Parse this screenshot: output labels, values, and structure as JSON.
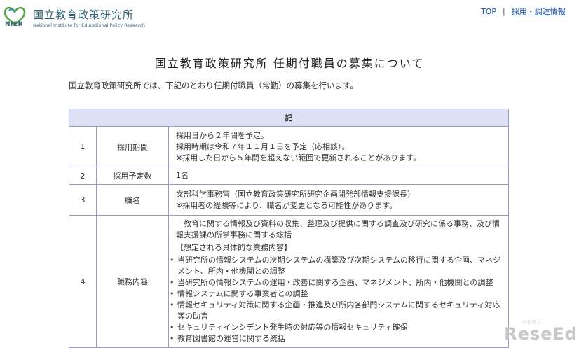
{
  "header": {
    "logo_title": "国立教育政策研究所",
    "logo_acronym": "NIER",
    "logo_subtitle": "National Institute for Educational Policy Research",
    "nav": [
      {
        "label": "TOP"
      },
      {
        "label": "採用・調達情報"
      }
    ],
    "nav_separator": "|"
  },
  "page": {
    "title": "国立教育政策研究所 任期付職員の募集について",
    "intro": "国立教育政策研究所では、下記のとおり任期付職員（常勤）の募集を行います。"
  },
  "table": {
    "header": "記",
    "rows": [
      {
        "num": "1",
        "label": "採用期間",
        "lines": [
          "採用日から２年間を予定。",
          "採用時期は令和７年１１月１日を予定（応相談）。",
          "※採用した日から５年間を超えない範囲で更新されることがあります。"
        ]
      },
      {
        "num": "2",
        "label": "採用予定数",
        "lines": [
          "1名"
        ]
      },
      {
        "num": "3",
        "label": "職名",
        "lines": [
          "文部科学事務官（国立教育政策研究所研究企画開発部情報支援課長）",
          "※採用者の経験等により、職名が変更となる可能性があります。"
        ]
      },
      {
        "num": "4",
        "label": "職務内容",
        "summary": "教育に関する情報及び資料の収集、整理及び提供に関する調査及び研究に係る事務、及び情報支援課の所掌事務に関する総括",
        "subheading": "【想定される具体的な業務内容】",
        "bullets": [
          "当研究所の情報システムの次期システムの構築及び次期システムの移行に関する企画、マネジメント、所内・他機関との調整",
          "当研究所の情報システムの運用・改善に関する企画、マネジメント、所内・他機関との調整",
          "情報システムに関する事業者との調整",
          "情報セキュリティ対策に関する企画・推進及び所内各部門システムに関するセキュリティ対応等の助言",
          "セキュリティインシデント発生時の対応等の情報セキュリティ確保",
          "教育図書館の運営に関する統括"
        ]
      }
    ]
  },
  "watermark": {
    "text": "ReseEd",
    "small": "リセマム"
  }
}
